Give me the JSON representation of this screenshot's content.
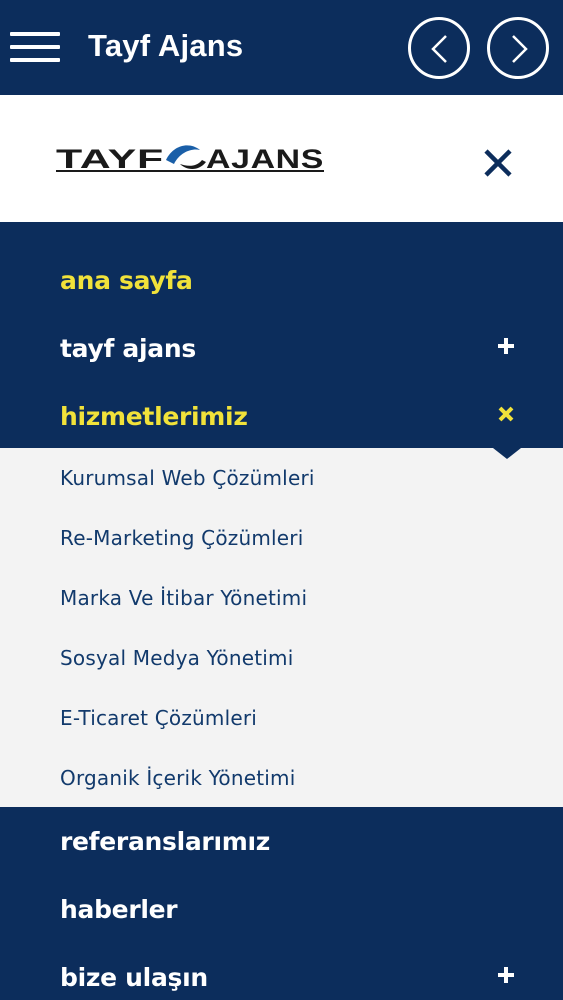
{
  "appbar": {
    "title": "Tayf Ajans",
    "menu_icon": "hamburger-icon",
    "prev_icon": "chevron-left-icon",
    "next_icon": "chevron-right-icon"
  },
  "drawer": {
    "logo_text": "TAYF AJANS",
    "close_icon": "close-icon",
    "items": [
      {
        "label": "ana sayfa",
        "active": true,
        "expander": ""
      },
      {
        "label": "tayf ajans",
        "active": false,
        "expander": "plus"
      },
      {
        "label": "hizmetlerimiz",
        "active": true,
        "expander": "close"
      },
      {
        "label": "referanslarımız",
        "active": false,
        "expander": ""
      },
      {
        "label": "haberler",
        "active": false,
        "expander": ""
      },
      {
        "label": "bize ulaşın",
        "active": false,
        "expander": "plus"
      }
    ],
    "submenu": [
      "Kurumsal Web Çözümleri",
      "Re-Marketing Çözümleri",
      "Marka Ve İtibar Yönetimi",
      "Sosyal Medya Yönetimi",
      "E-Ticaret Çözümleri",
      "Organik İçerik Yönetimi"
    ]
  },
  "colors": {
    "navy": "#0c2d5c",
    "active_yellow": "#f1e23a",
    "submenu_bg": "#f3f3f3",
    "submenu_text": "#123a6c"
  }
}
